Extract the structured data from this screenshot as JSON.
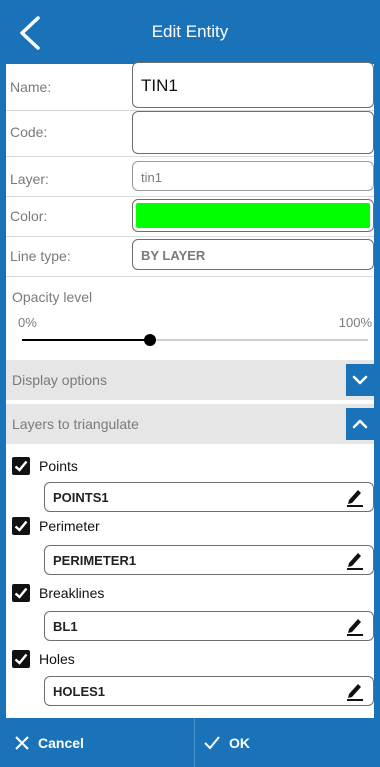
{
  "header": {
    "title": "Edit Entity"
  },
  "form": {
    "name": {
      "label": "Name:",
      "value": "TIN1"
    },
    "code": {
      "label": "Code:",
      "value": ""
    },
    "layer": {
      "label": "Layer:",
      "value": "tin1"
    },
    "color": {
      "label": "Color:",
      "value": "#00ff00"
    },
    "line_type": {
      "label": "Line type:",
      "value": "BY LAYER"
    }
  },
  "opacity": {
    "label": "Opacity level",
    "min_label": "0%",
    "max_label": "100%",
    "level": 0.37
  },
  "sections": {
    "display_options": {
      "label": "Display options",
      "expanded": false
    },
    "layers_to_triangulate": {
      "label": "Layers to triangulate",
      "expanded": true
    }
  },
  "layers": [
    {
      "label": "Points",
      "checked": true,
      "value": "POINTS1"
    },
    {
      "label": "Perimeter",
      "checked": true,
      "value": "PERIMETER1"
    },
    {
      "label": "Breaklines",
      "checked": true,
      "value": "BL1"
    },
    {
      "label": "Holes",
      "checked": true,
      "value": "HOLES1"
    }
  ],
  "footer": {
    "cancel_label": "Cancel",
    "ok_label": "OK"
  },
  "colors": {
    "accent": "#1a73b8",
    "section_bg": "#e6e6e6",
    "entity_color": "#00ff00"
  },
  "icons": {
    "back": "chevron-left-icon",
    "expand": "chevron-down-icon",
    "collapse": "chevron-up-icon",
    "edit": "pencil-icon",
    "cancel": "close-icon",
    "ok": "check-icon"
  }
}
